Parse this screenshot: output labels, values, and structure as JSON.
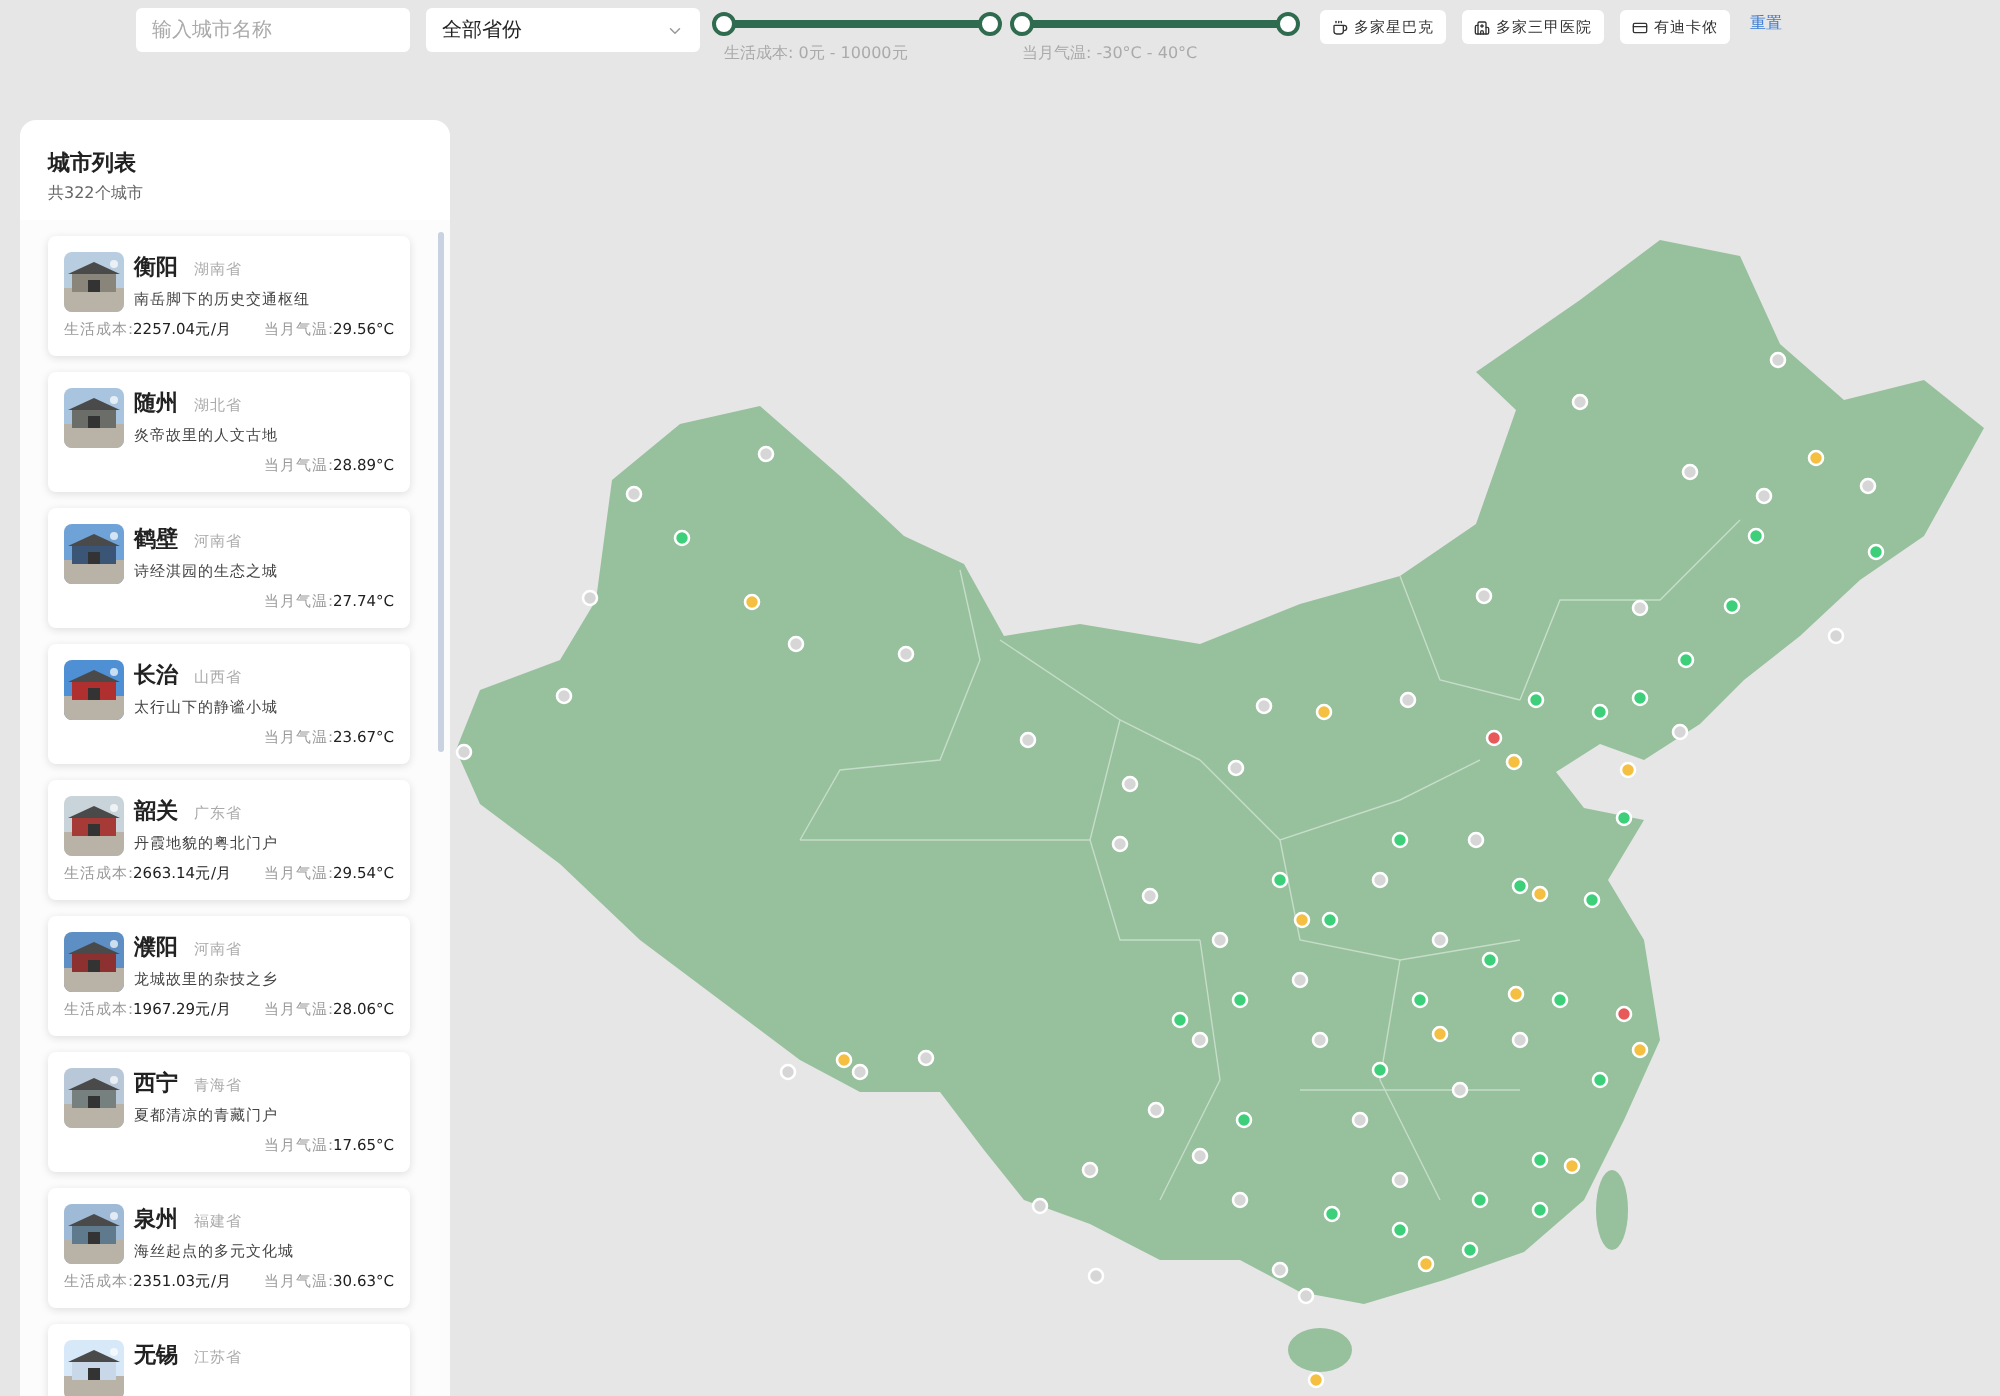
{
  "filters": {
    "search": {
      "placeholder": "输入城市名称"
    },
    "province_select": {
      "value": "全部省份"
    },
    "cost_slider": {
      "thumbs": [
        {
          "level": 0
        },
        {
          "level": 1
        }
      ],
      "caption": "生活成本: 0元 - 10000元"
    },
    "temp_slider": {
      "thumbs": [
        {
          "level": 0
        },
        {
          "level": 1
        }
      ],
      "caption": "当月气温: -30°C - 40°C"
    },
    "buttons": [
      {
        "kind": "coffee",
        "label": "多家星巴克"
      },
      {
        "kind": "hospital",
        "label": "多家三甲医院"
      },
      {
        "kind": "card",
        "label": "有迪卡侬"
      }
    ],
    "reset": "重置"
  },
  "city_list": {
    "title": "城市列表",
    "count": "共322个城市",
    "cities": [
      {
        "name": "衡阳",
        "province": "湖南省",
        "slogan": "南岳脚下的历史交通枢纽",
        "cost_label": "生活成本:",
        "cost": "2257.04元/月",
        "temp_label": "当月气温:",
        "temp": "29.56°C"
      },
      {
        "name": "随州",
        "province": "湖北省",
        "slogan": "炎帝故里的人文古地",
        "temp_label": "当月气温:",
        "temp": "28.89°C"
      },
      {
        "name": "鹤壁",
        "province": "河南省",
        "slogan": "诗经淇园的生态之城",
        "temp_label": "当月气温:",
        "temp": "27.74°C"
      },
      {
        "name": "长治",
        "province": "山西省",
        "slogan": "太行山下的静谧小城",
        "temp_label": "当月气温:",
        "temp": "23.67°C"
      },
      {
        "name": "韶关",
        "province": "广东省",
        "slogan": "丹霞地貌的粤北门户",
        "cost_label": "生活成本:",
        "cost": "2663.14元/月",
        "temp_label": "当月气温:",
        "temp": "29.54°C"
      },
      {
        "name": "濮阳",
        "province": "河南省",
        "slogan": "龙城故里的杂技之乡",
        "cost_label": "生活成本:",
        "cost": "1967.29元/月",
        "temp_label": "当月气温:",
        "temp": "28.06°C"
      },
      {
        "name": "西宁",
        "province": "青海省",
        "slogan": "夏都清凉的青藏门户",
        "temp_label": "当月气温:",
        "temp": "17.65°C"
      },
      {
        "name": "泉州",
        "province": "福建省",
        "slogan": "海丝起点的多元文化城",
        "cost_label": "生活成本:",
        "cost": "2351.03元/月",
        "temp_label": "当月气温:",
        "temp": "30.63°C"
      },
      {
        "name": "无锡",
        "province": "江苏省"
      }
    ]
  },
  "map": {
    "markers": [
      {
        "color": "#d6d6d6"
      },
      {
        "color": "#d6d6d6"
      },
      {
        "color": "#d6d6d6"
      },
      {
        "color": "#d6d6d6"
      },
      {
        "color": "#d6d6d6"
      },
      {
        "color": "#d6d6d6"
      },
      {
        "color": "#d6d6d6"
      },
      {
        "color": "#d6d6d6"
      },
      {
        "color": "#d6d6d6"
      },
      {
        "color": "#d6d6d6"
      },
      {
        "color": "#d6d6d6"
      },
      {
        "color": "#d6d6d6"
      },
      {
        "color": "#d6d6d6"
      },
      {
        "color": "#d6d6d6"
      },
      {
        "color": "#d6d6d6"
      },
      {
        "color": "#d6d6d6"
      },
      {
        "color": "#d6d6d6"
      },
      {
        "color": "#d6d6d6"
      },
      {
        "color": "#d6d6d6"
      },
      {
        "color": "#d6d6d6"
      },
      {
        "color": "#d6d6d6"
      },
      {
        "color": "#d6d6d6"
      },
      {
        "color": "#d6d6d6"
      },
      {
        "color": "#d6d6d6"
      },
      {
        "color": "#d6d6d6"
      },
      {
        "color": "#d6d6d6"
      },
      {
        "color": "#d6d6d6"
      },
      {
        "color": "#d6d6d6"
      },
      {
        "color": "#d6d6d6"
      },
      {
        "color": "#d6d6d6"
      },
      {
        "color": "#d6d6d6"
      },
      {
        "color": "#d6d6d6"
      },
      {
        "color": "#d6d6d6"
      },
      {
        "color": "#d6d6d6"
      },
      {
        "color": "#d6d6d6"
      },
      {
        "color": "#d6d6d6"
      },
      {
        "color": "#d6d6d6"
      },
      {
        "color": "#d6d6d6"
      },
      {
        "color": "#d6d6d6"
      },
      {
        "color": "#d6d6d6"
      },
      {
        "color": "#d6d6d6"
      },
      {
        "color": "#d6d6d6"
      },
      {
        "color": "#d6d6d6"
      },
      {
        "color": "#d6d6d6"
      },
      {
        "color": "#d6d6d6"
      },
      {
        "color": "#3ecf7a"
      },
      {
        "color": "#3ecf7a"
      },
      {
        "color": "#3ecf7a"
      },
      {
        "color": "#3ecf7a"
      },
      {
        "color": "#3ecf7a"
      },
      {
        "color": "#3ecf7a"
      },
      {
        "color": "#3ecf7a"
      },
      {
        "color": "#3ecf7a"
      },
      {
        "color": "#3ecf7a"
      },
      {
        "color": "#3ecf7a"
      },
      {
        "color": "#3ecf7a"
      },
      {
        "color": "#3ecf7a"
      },
      {
        "color": "#3ecf7a"
      },
      {
        "color": "#3ecf7a"
      },
      {
        "color": "#3ecf7a"
      },
      {
        "color": "#3ecf7a"
      },
      {
        "color": "#3ecf7a"
      },
      {
        "color": "#3ecf7a"
      },
      {
        "color": "#3ecf7a"
      },
      {
        "color": "#3ecf7a"
      },
      {
        "color": "#3ecf7a"
      },
      {
        "color": "#3ecf7a"
      },
      {
        "color": "#3ecf7a"
      },
      {
        "color": "#3ecf7a"
      },
      {
        "color": "#3ecf7a"
      },
      {
        "color": "#3ecf7a"
      },
      {
        "color": "#3ecf7a"
      },
      {
        "color": "#3ecf7a"
      },
      {
        "color": "#f5bf42"
      },
      {
        "color": "#f5bf42"
      },
      {
        "color": "#f5bf42"
      },
      {
        "color": "#f5bf42"
      },
      {
        "color": "#f5bf42"
      },
      {
        "color": "#f5bf42"
      },
      {
        "color": "#f5bf42"
      },
      {
        "color": "#f5bf42"
      },
      {
        "color": "#f5bf42"
      },
      {
        "color": "#f5bf42"
      },
      {
        "color": "#f5bf42"
      },
      {
        "color": "#f5bf42"
      },
      {
        "color": "#f5bf42"
      },
      {
        "color": "#f5bf42"
      },
      {
        "color": "#e85a5a"
      },
      {
        "color": "#e85a5a"
      }
    ]
  }
}
